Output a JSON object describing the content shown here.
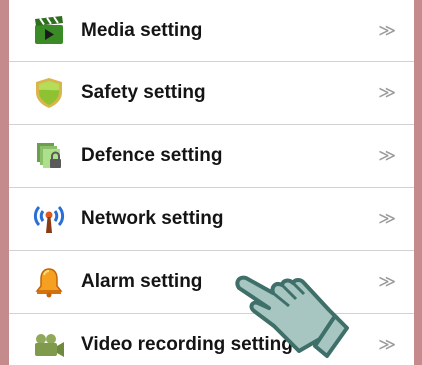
{
  "menu": {
    "items": [
      {
        "label": "Media setting",
        "icon": "media-clapperboard-icon",
        "chevron": "≫"
      },
      {
        "label": "Safety setting",
        "icon": "shield-icon",
        "chevron": "≫"
      },
      {
        "label": "Defence setting",
        "icon": "locked-documents-icon",
        "chevron": "≫"
      },
      {
        "label": "Network setting",
        "icon": "antenna-icon",
        "chevron": "≫"
      },
      {
        "label": "Alarm setting",
        "icon": "bell-icon",
        "chevron": "≫"
      },
      {
        "label": "Video recording setting",
        "icon": "video-camera-icon",
        "chevron": "≫"
      }
    ]
  },
  "colors": {
    "frame_border": "#c48a8c",
    "divider": "#d2d2d2",
    "chevron": "#9a9a9a",
    "hand_fill": "#a7c6c2",
    "hand_outline": "#3f6f69"
  }
}
